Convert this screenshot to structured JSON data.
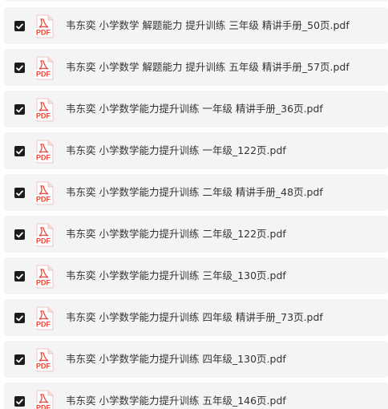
{
  "file_list": {
    "items": [
      {
        "name": "韦东奕 小学数学 解题能力 提升训练 三年级 精讲手册_50页.pdf",
        "checked": true,
        "icon": "pdf-icon",
        "icon_label": "PDF"
      },
      {
        "name": "韦东奕 小学数学 解题能力 提升训练 五年级 精讲手册_57页.pdf",
        "checked": true,
        "icon": "pdf-icon",
        "icon_label": "PDF"
      },
      {
        "name": "韦东奕 小学数学能力提升训练 一年级 精讲手册_36页.pdf",
        "checked": true,
        "icon": "pdf-icon",
        "icon_label": "PDF"
      },
      {
        "name": "韦东奕 小学数学能力提升训练 一年级_122页.pdf",
        "checked": true,
        "icon": "pdf-icon",
        "icon_label": "PDF"
      },
      {
        "name": "韦东奕 小学数学能力提升训练 二年级 精讲手册_48页.pdf",
        "checked": true,
        "icon": "pdf-icon",
        "icon_label": "PDF"
      },
      {
        "name": "韦东奕 小学数学能力提升训练 二年级_122页.pdf",
        "checked": true,
        "icon": "pdf-icon",
        "icon_label": "PDF"
      },
      {
        "name": "韦东奕 小学数学能力提升训练 三年级_130页.pdf",
        "checked": true,
        "icon": "pdf-icon",
        "icon_label": "PDF"
      },
      {
        "name": "韦东奕 小学数学能力提升训练 四年级 精讲手册_73页.pdf",
        "checked": true,
        "icon": "pdf-icon",
        "icon_label": "PDF"
      },
      {
        "name": "韦东奕 小学数学能力提升训练 四年级_130页.pdf",
        "checked": true,
        "icon": "pdf-icon",
        "icon_label": "PDF"
      },
      {
        "name": "韦东奕 小学数学能力提升训练 五年级_146页.pdf",
        "checked": true,
        "icon": "pdf-icon",
        "icon_label": "PDF"
      }
    ]
  },
  "colors": {
    "row_background": "#f4f4f5",
    "checkbox": "#1c1c1c",
    "pdf_red": "#e8483a",
    "text": "#333333"
  }
}
